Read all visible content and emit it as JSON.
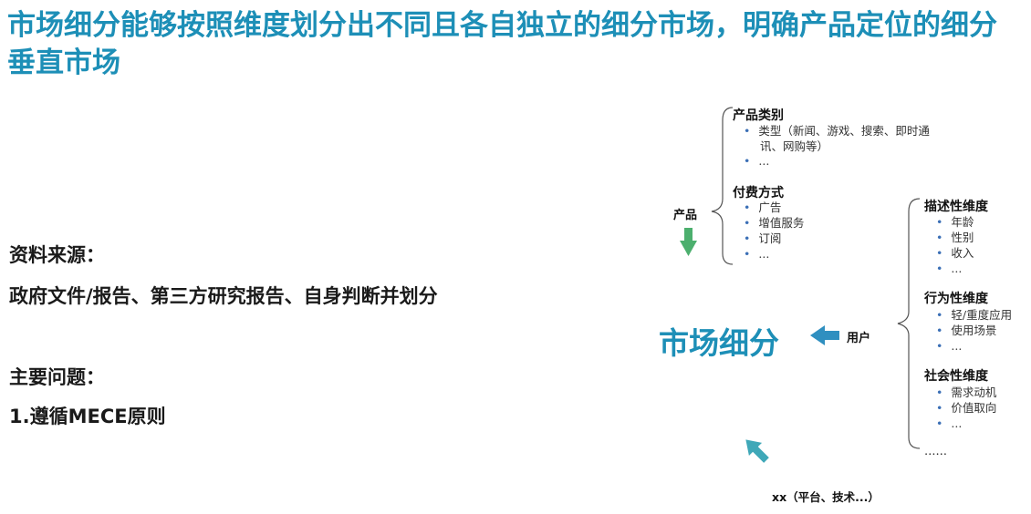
{
  "title": "市场细分能够按照维度划分出不同且各自独立的细分市场，明确产品定位的细分垂直市场",
  "left": {
    "source_heading": "资料来源：",
    "source_text": "政府文件/报告、第三方研究报告、自身判断并划分",
    "problem_heading": "主要问题：",
    "problem_item": "1.遵循MECE原则"
  },
  "diagram": {
    "center": "市场细分",
    "product_label": "产品",
    "user_label": "用户",
    "xx_label": "xx（平台、技术...）",
    "product_groups": [
      {
        "heading": "产品类别",
        "items": [
          "类型（新闻、游戏、搜索、即时通讯、网购等）",
          "..."
        ]
      },
      {
        "heading": "付费方式",
        "items": [
          "广告",
          "增值服务",
          "订阅",
          "..."
        ]
      }
    ],
    "user_groups": [
      {
        "heading": "描述性维度",
        "items": [
          "年龄",
          "性别",
          "收入",
          "..."
        ]
      },
      {
        "heading": "行为性维度",
        "items": [
          "轻/重度应用",
          "使用场景",
          "..."
        ]
      },
      {
        "heading": "社会性维度",
        "items": [
          "需求动机",
          "价值取向",
          "..."
        ]
      }
    ],
    "more": "……",
    "colors": {
      "accent": "#1d8fb7",
      "green_arrow": "#4caf6e",
      "blue_arrow": "#2f8fc0",
      "teal_arrow": "#3fa8b8"
    }
  }
}
